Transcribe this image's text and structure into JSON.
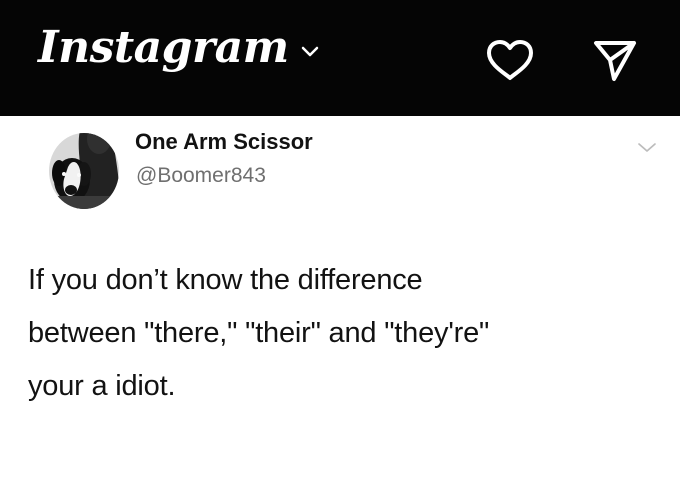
{
  "header": {
    "app_title": "Instagram",
    "icons": [
      "chevron-down-icon",
      "heart-icon",
      "send-icon"
    ],
    "background_color": "#050505",
    "foreground_color": "#ffffff"
  },
  "post": {
    "author": {
      "display_name": "One Arm Scissor",
      "handle": "@Boomer843",
      "avatar_icon": "avatar-dog-photo"
    },
    "menu_icon": "chevron-down-icon",
    "text_lines": [
      "If you don’t know the difference",
      "between \"there,\" \"their\" and \"they're\"",
      "your a idiot."
    ],
    "text_color": "#121212",
    "handle_color": "#6f6f6f"
  }
}
